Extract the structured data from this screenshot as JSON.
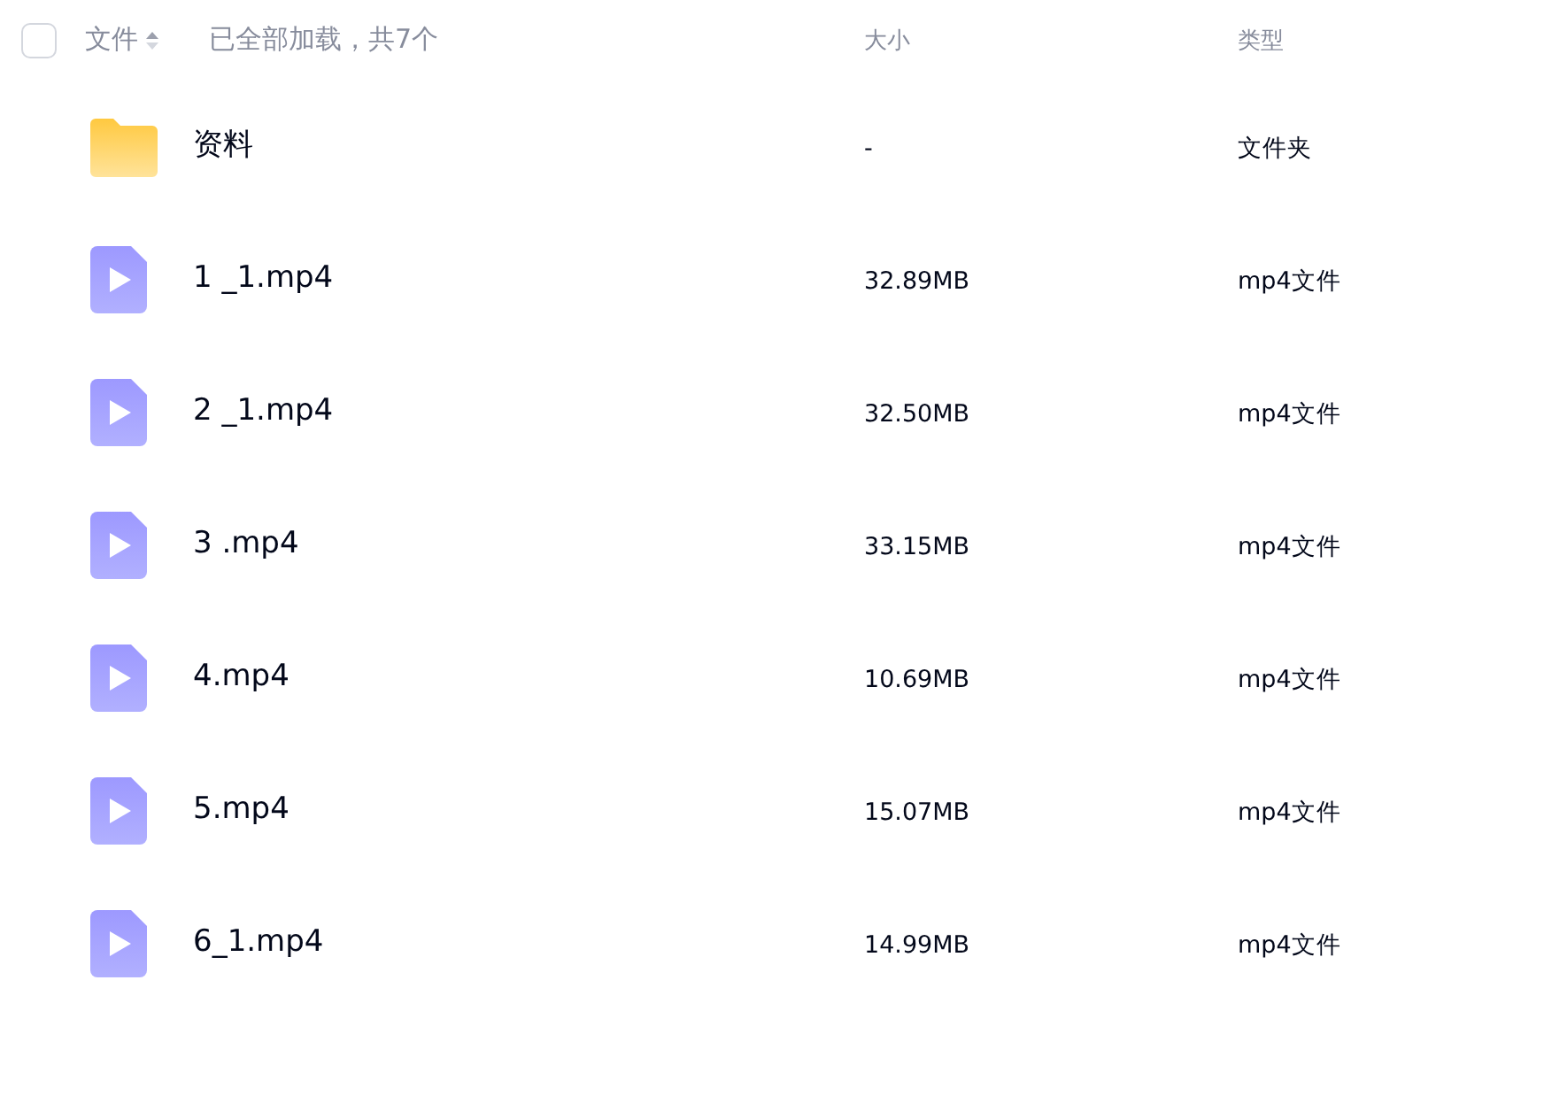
{
  "header": {
    "select_all": {
      "checked": false
    },
    "name_label": "文件",
    "status": "已全部加载，共7个",
    "size_label": "大小",
    "type_label": "类型"
  },
  "files": [
    {
      "kind": "folder",
      "name": "资料",
      "size": "-",
      "type": "文件夹"
    },
    {
      "kind": "video",
      "name": "1 _1.mp4",
      "size": "32.89MB",
      "type": "mp4文件"
    },
    {
      "kind": "video",
      "name": "2 _1.mp4",
      "size": "32.50MB",
      "type": "mp4文件"
    },
    {
      "kind": "video",
      "name": "3 .mp4",
      "size": "33.15MB",
      "type": "mp4文件"
    },
    {
      "kind": "video",
      "name": "4.mp4",
      "size": "10.69MB",
      "type": "mp4文件"
    },
    {
      "kind": "video",
      "name": "5.mp4",
      "size": "15.07MB",
      "type": "mp4文件"
    },
    {
      "kind": "video",
      "name": "6_1.mp4",
      "size": "14.99MB",
      "type": "mp4文件"
    }
  ]
}
